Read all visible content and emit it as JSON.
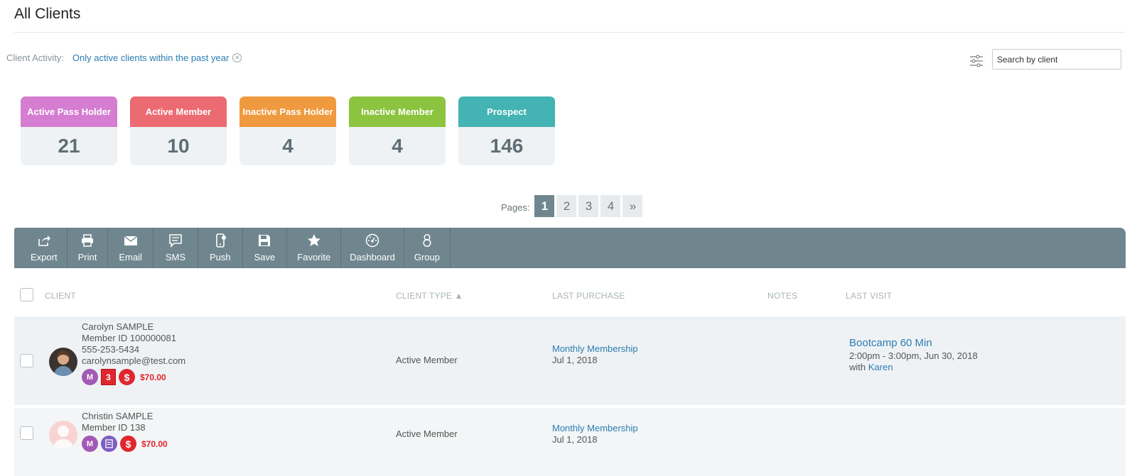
{
  "page": {
    "title": "All Clients"
  },
  "activity": {
    "label": "Client Activity:",
    "value": "Only active clients within the past year",
    "clear_icon": "close-circle-icon"
  },
  "search": {
    "placeholder": "Search by client",
    "filter_icon": "sliders-icon"
  },
  "cards": [
    {
      "label": "Active Pass Holder",
      "count": "21",
      "color": "#d57dd0"
    },
    {
      "label": "Active Member",
      "count": "10",
      "color": "#ec6a72"
    },
    {
      "label": "Inactive Pass Holder",
      "count": "4",
      "color": "#ef9a3e"
    },
    {
      "label": "Inactive Member",
      "count": "4",
      "color": "#8cc43f"
    },
    {
      "label": "Prospect",
      "count": "146",
      "color": "#43b3b3"
    }
  ],
  "pager": {
    "label": "Pages:",
    "pages": [
      "1",
      "2",
      "3",
      "4"
    ],
    "next": "»",
    "current": "1"
  },
  "toolbar": [
    {
      "label": "Export",
      "icon": "export-icon"
    },
    {
      "label": "Print",
      "icon": "print-icon"
    },
    {
      "label": "Email",
      "icon": "email-icon"
    },
    {
      "label": "SMS",
      "icon": "sms-icon"
    },
    {
      "label": "Push",
      "icon": "push-icon"
    },
    {
      "label": "Save",
      "icon": "save-icon"
    },
    {
      "label": "Favorite",
      "icon": "star-icon"
    },
    {
      "label": "Dashboard",
      "icon": "dashboard-icon"
    },
    {
      "label": "Group",
      "icon": "group-icon"
    }
  ],
  "table": {
    "columns": {
      "client": "CLIENT",
      "client_type": "CLIENT TYPE ▲",
      "last_purchase": "LAST PURCHASE",
      "notes": "NOTES",
      "last_visit": "LAST VISIT"
    },
    "rows": [
      {
        "name": "Carolyn SAMPLE",
        "member_id": "Member ID 100000081",
        "phone": "555-253-5434",
        "email": "carolynsample@test.com",
        "badge_m": "M",
        "badge_count": "3",
        "badge_dollar": "$",
        "balance": "$70.00",
        "client_type": "Active Member",
        "purchase_name": "Monthly Membership",
        "purchase_date": "Jul 1, 2018",
        "visit_title": "Bootcamp 60 Min",
        "visit_time": "2:00pm - 3:00pm, Jun 30, 2018",
        "visit_with": "with",
        "visit_instructor": "Karen"
      },
      {
        "name": "Christin SAMPLE",
        "member_id": "Member ID 138",
        "badge_m": "M",
        "badge_dollar": "$",
        "balance": "$70.00",
        "client_type": "Active Member",
        "purchase_name": "Monthly Membership",
        "purchase_date": "Jul 1, 2018"
      }
    ]
  }
}
